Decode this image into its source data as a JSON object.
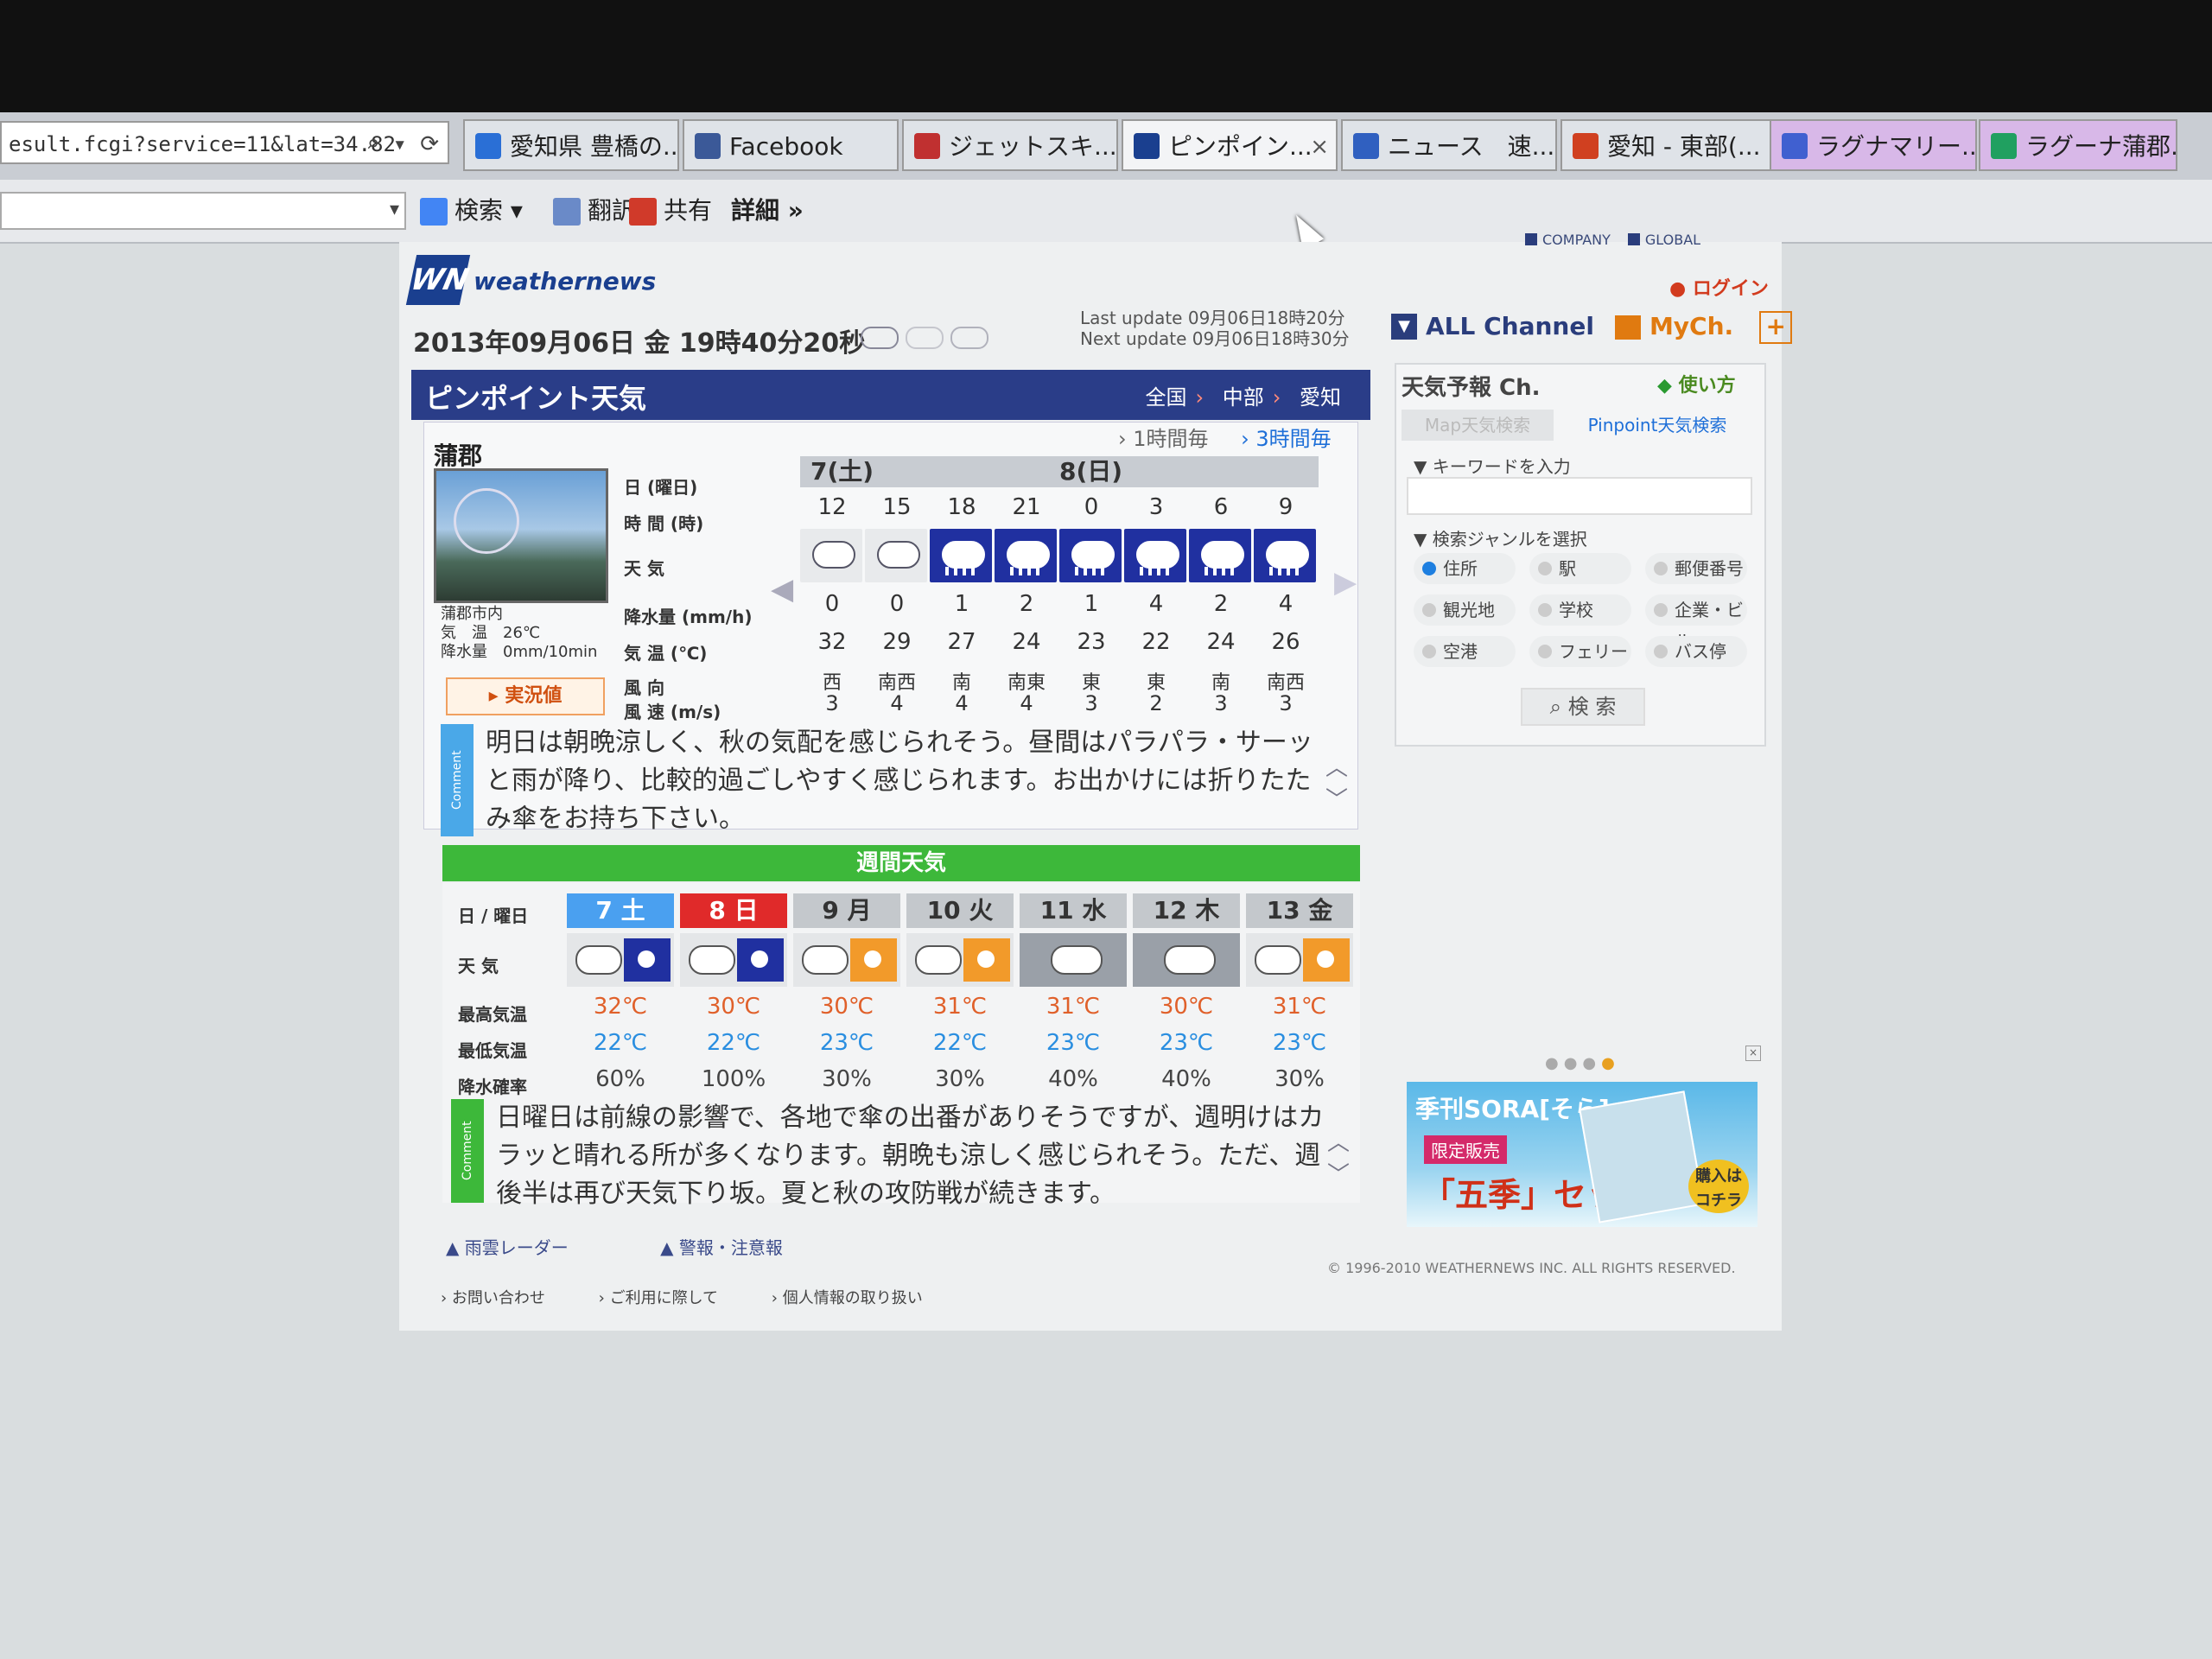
{
  "browser": {
    "url": "esult.fcgi?service=11&lat=34.82",
    "tabs": [
      {
        "label": "愛知県 豊橋の...",
        "color": "#2a6fd6"
      },
      {
        "label": "Facebook",
        "color": "#3b5998"
      },
      {
        "label": "ジェットスキ...",
        "color": "#c03030"
      },
      {
        "label": "ピンポイン...",
        "color": "#1a3f8f"
      },
      {
        "label": "ニュース　速...",
        "color": "#3060c0"
      },
      {
        "label": "愛知 - 東部(...",
        "color": "#d04020"
      },
      {
        "label": "ラグナマリー...",
        "color": "#4060d0"
      },
      {
        "label": "ラグーナ蒲郡...",
        "color": "#20a060"
      }
    ],
    "toolbar": {
      "search_label": "検索",
      "translate_label": "翻訳",
      "share_label": "共有",
      "details_label": "詳細 »"
    }
  },
  "header": {
    "company_link": "COMPANY",
    "global_link": "GLOBAL",
    "logo_mark": "WN",
    "logo_text": "weathernews",
    "login": "ログイン",
    "date": "2013年09月06日 金 19時40分20秒",
    "last_update": "Last update  09月06日18時20分",
    "next_update": "Next update  09月06日18時30分",
    "all_channel": "ALL Channel",
    "mych": "MyCh.",
    "plus": "+"
  },
  "pinpoint": {
    "title": "ピンポイント天気",
    "crumbs": [
      "全国",
      "中部",
      "愛知"
    ],
    "interval_1h": "1時間毎",
    "interval_3h": "3時間毎",
    "location": "蒲郡",
    "live_place": "蒲郡市内",
    "live_temp": "気　温　26℃",
    "live_rain": "降水量　0mm/10min",
    "live_button": "実況値",
    "labels": {
      "day": "日 (曜日)",
      "time": "時 間 (時)",
      "weather": "天 気",
      "precip": "降水量 (mm/h)",
      "temp": "気 温 (℃)",
      "wind_dir": "風 向",
      "wind_speed": "風 速 (m/s)"
    },
    "day1": "7(土)",
    "day2": "8(日)",
    "hours": [
      "12",
      "15",
      "18",
      "21",
      "0",
      "3",
      "6",
      "9"
    ],
    "weather": [
      "cloud",
      "cloud",
      "rain",
      "rain",
      "rain",
      "rain",
      "rain",
      "rain"
    ],
    "precip": [
      "0",
      "0",
      "1",
      "2",
      "1",
      "4",
      "2",
      "4"
    ],
    "temp": [
      "32",
      "29",
      "27",
      "24",
      "23",
      "22",
      "24",
      "26"
    ],
    "wind_dir": [
      "西",
      "南西",
      "南",
      "南東",
      "東",
      "東",
      "南",
      "南西"
    ],
    "wind_speed": [
      "3",
      "4",
      "4",
      "4",
      "3",
      "2",
      "3",
      "3"
    ],
    "comment_tag": "Comment",
    "comment": "明日は朝晩涼しく、秋の気配を感じられそう。昼間はパラパラ・サーッと雨が降り、比較的過ごしやすく感じられます。お出かけには折りたたみ傘をお持ち下さい。"
  },
  "weekly": {
    "title": "週間天気",
    "labels": {
      "day": "日 / 曜日",
      "weather": "天 気",
      "high": "最高気温",
      "low": "最低気温",
      "pop": "降水確率"
    },
    "days": [
      "7 土",
      "8 日",
      "9 月",
      "10 火",
      "11 水",
      "12 木",
      "13 金"
    ],
    "icons": [
      "cloud-rain",
      "cloud-rain",
      "cloud-sun",
      "cloud-sun",
      "cloud",
      "cloud",
      "cloud-sun"
    ],
    "high": [
      "32℃",
      "30℃",
      "30℃",
      "31℃",
      "31℃",
      "30℃",
      "31℃"
    ],
    "low": [
      "22℃",
      "22℃",
      "23℃",
      "22℃",
      "23℃",
      "23℃",
      "23℃"
    ],
    "pop": [
      "60%",
      "100%",
      "30%",
      "30%",
      "40%",
      "40%",
      "30%"
    ],
    "comment_tag": "Comment",
    "comment": "日曜日は前線の影響で、各地で傘の出番がありそうですが、週明けはカラッと晴れる所が多くなります。朝晩も涼しく感じられそう。ただ、週後半は再び天気下り坂。夏と秋の攻防戦が続きます。"
  },
  "links": {
    "radar": "雨雲レーダー",
    "warnings": "警報・注意報",
    "contact": "お問い合わせ",
    "terms": "ご利用に際して",
    "privacy": "個人情報の取り扱い",
    "copyright": "© 1996-2010 WEATHERNEWS INC. ALL RIGHTS RESERVED."
  },
  "side": {
    "title": "天気予報 Ch.",
    "howto": "使い方",
    "tab_map": "Map天気検索",
    "tab_pinpoint": "Pinpoint天気検索",
    "keyword_label": "▼ キーワードを入力",
    "genre_label": "▼ 検索ジャンルを選択",
    "genres": [
      "住所",
      "駅",
      "郵便番号",
      "観光地",
      "学校",
      "企業・ビル",
      "空港",
      "フェリー",
      "バス停"
    ],
    "search_button": "検 索",
    "ad_title": "季刊SORA[そら]",
    "ad_badge": "限定販売",
    "ad_big": "「五季」セット",
    "ad_buy": "購入はコチラ"
  }
}
